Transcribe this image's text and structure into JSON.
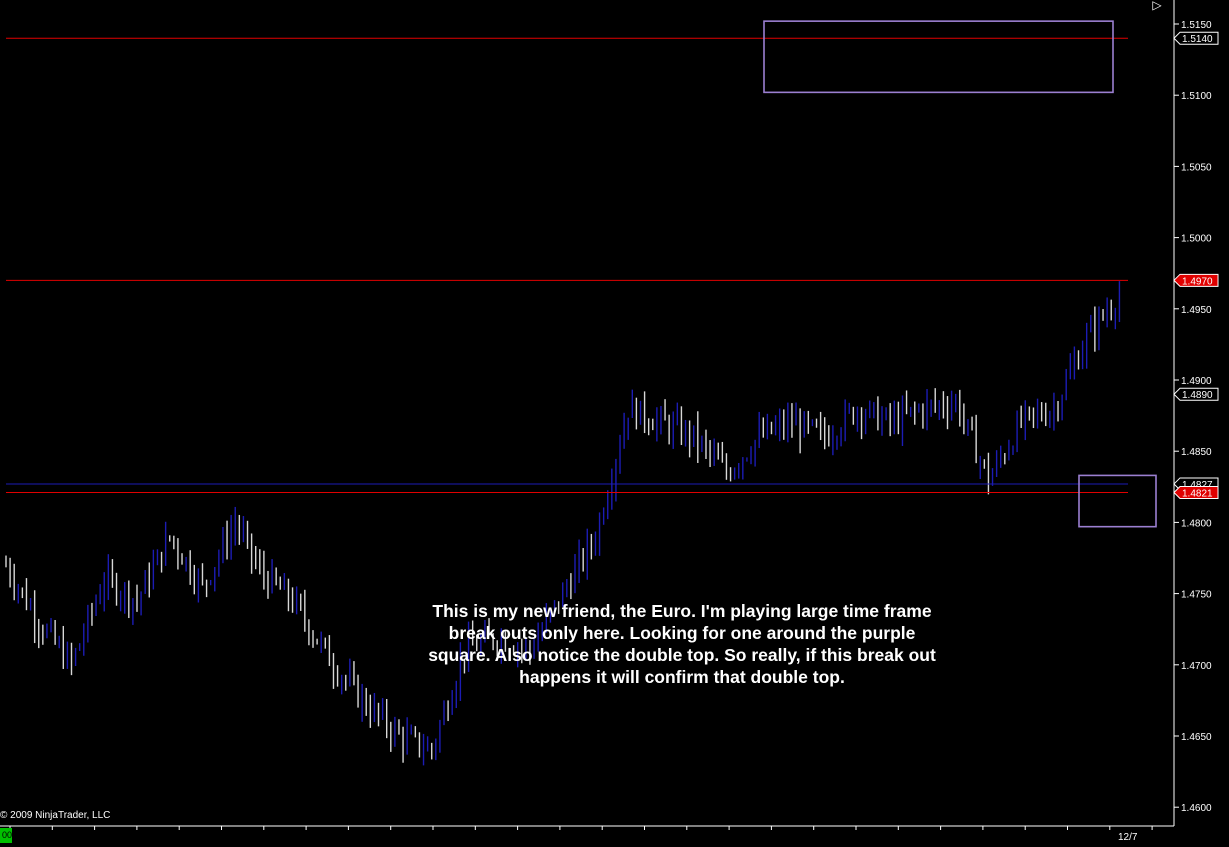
{
  "chart_data": {
    "type": "ohlc",
    "title": "",
    "xlabel": "",
    "ylabel": "",
    "y_range": [
      1.4595,
      1.5155
    ],
    "price_ticks": [
      "1.5150",
      "1.5100",
      "1.5050",
      "1.5000",
      "1.4950",
      "1.4900",
      "1.4850",
      "1.4800",
      "1.4750",
      "1.4700",
      "1.4650",
      "1.4600"
    ],
    "x_tick_labels": [
      "12/7"
    ],
    "bar_count": 273,
    "closes_anchor_path": [
      [
        0,
        1.477
      ],
      [
        8,
        1.473
      ],
      [
        16,
        1.47
      ],
      [
        24,
        1.476
      ],
      [
        32,
        1.4745
      ],
      [
        40,
        1.479
      ],
      [
        48,
        1.4755
      ],
      [
        56,
        1.48
      ],
      [
        62,
        1.4765
      ],
      [
        70,
        1.4745
      ],
      [
        80,
        1.47
      ],
      [
        88,
        1.4672
      ],
      [
        96,
        1.465
      ],
      [
        104,
        1.464
      ],
      [
        112,
        1.471
      ],
      [
        120,
        1.472
      ],
      [
        128,
        1.471
      ],
      [
        136,
        1.475
      ],
      [
        144,
        1.479
      ],
      [
        152,
        1.488
      ],
      [
        160,
        1.487
      ],
      [
        168,
        1.486
      ],
      [
        176,
        1.4835
      ],
      [
        184,
        1.486
      ],
      [
        192,
        1.487
      ],
      [
        200,
        1.486
      ],
      [
        208,
        1.488
      ],
      [
        216,
        1.487
      ],
      [
        224,
        1.488
      ],
      [
        232,
        1.4885
      ],
      [
        240,
        1.483
      ],
      [
        248,
        1.487
      ],
      [
        256,
        1.488
      ],
      [
        264,
        1.493
      ],
      [
        272,
        1.496
      ]
    ],
    "last_bar": {
      "x_fraction": 0.965,
      "value": 1.489
    },
    "levels": [
      {
        "value": 1.514,
        "color": "#e00000"
      },
      {
        "value": 1.497,
        "color": "#e00000"
      },
      {
        "value": 1.4827,
        "color": "#1c1cb4"
      },
      {
        "value": 1.4821,
        "color": "#e00000"
      }
    ],
    "price_markers": [
      {
        "label": "1.5140",
        "value": 1.514,
        "style": "outline"
      },
      {
        "label": "1.4970",
        "value": 1.497,
        "style": "red"
      },
      {
        "label": "1.4890",
        "value": 1.489,
        "style": "outline"
      },
      {
        "label": "1.4827",
        "value": 1.4827,
        "style": "outline"
      },
      {
        "label": "1.4821",
        "value": 1.4821,
        "style": "red"
      }
    ],
    "highlight_boxes": [
      {
        "kind": "double top",
        "price_range": [
          1.5102,
          1.5152
        ]
      },
      {
        "kind": "breakout zone",
        "price_range": [
          1.4797,
          1.4833
        ]
      }
    ],
    "colors": {
      "background": "#000000",
      "bar_up": "#1c1cb4",
      "bar_down": "#d8d8d8",
      "level": "#e00000",
      "highlight_box": "#9b7fd1",
      "axis_text": "#ffffff"
    }
  },
  "annotation_text": "This is my new friend, the Euro. I'm playing large time frame\nbreak outs only here. Looking for one around the purple\nsquare. Also notice the double top.  So really, if this break out\nhappens it will confirm that double top.",
  "copyright": "© 2009 NinjaTrader, LLC",
  "corner_tag": "00",
  "scroll_arrow_icon": "▷"
}
